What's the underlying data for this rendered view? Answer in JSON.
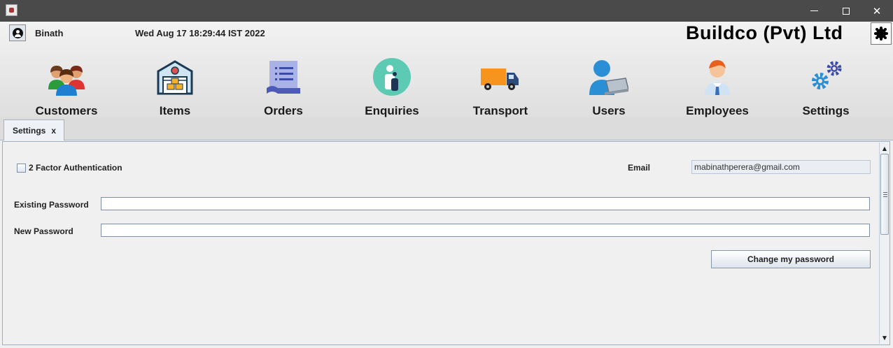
{
  "user": {
    "name": "Binath",
    "icon": "user-account-icon"
  },
  "datetime": "Wed Aug 17 18:29:44 IST 2022",
  "company": "Buildco (Pvt) Ltd",
  "theme_icon": "sun-icon",
  "nav": [
    {
      "label": "Customers",
      "icon": "customers-icon"
    },
    {
      "label": "Items",
      "icon": "warehouse-icon"
    },
    {
      "label": "Orders",
      "icon": "orders-document-icon"
    },
    {
      "label": "Enquiries",
      "icon": "info-icon"
    },
    {
      "label": "Transport",
      "icon": "truck-icon"
    },
    {
      "label": "Users",
      "icon": "user-laptop-icon"
    },
    {
      "label": "Employees",
      "icon": "employee-icon"
    },
    {
      "label": "Settings",
      "icon": "gears-icon"
    }
  ],
  "tab": {
    "label": "Settings",
    "close": "x"
  },
  "settings": {
    "two_factor_label": "2 Factor Authentication",
    "two_factor_checked": false,
    "email_label": "Email",
    "email_value": "mabinathperera@gmail.com",
    "existing_password_label": "Existing Password",
    "new_password_label": "New Password",
    "change_button": "Change my password"
  },
  "colors": {
    "titlebar": "#4a4a4a",
    "teal": "#5dcab3",
    "truck_orange": "#f7941d"
  }
}
